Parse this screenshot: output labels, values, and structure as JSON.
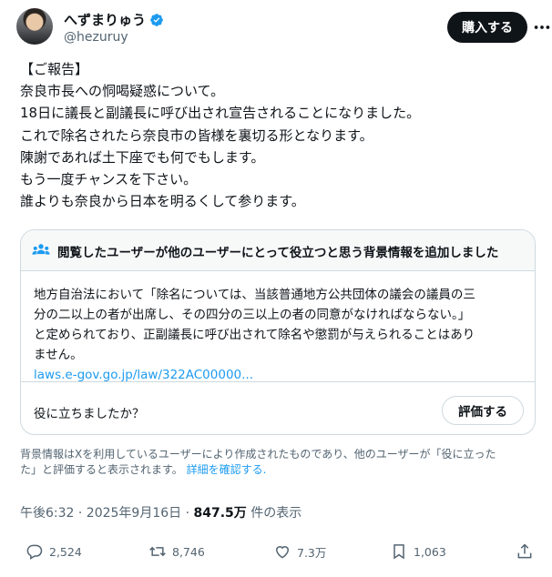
{
  "user": {
    "display_name": "へずまりゅう",
    "handle": "@hezuruy",
    "verified_icon": "verified-badge-icon"
  },
  "header": {
    "buy_label": "購入する",
    "more_icon": "more-icon"
  },
  "tweet": {
    "lines": [
      "【ご報告】",
      "奈良市長への恫喝疑惑について。",
      "18日に議長と副議長に呼び出され宣告されることになりました。",
      "これで除名されたら奈良市の皆様を裏切る形となります。",
      "陳謝であれば土下座でも何でもします。",
      "もう一度チャンスを下さい。",
      "誰よりも奈良から日本を明るくして参ります。"
    ]
  },
  "community_note": {
    "title": "閲覧したユーザーが他のユーザーにとって役立つと思う背景情報を追加しました",
    "body_lines": [
      "地方自治法において「除名については、当該普通地方公共団体の議会の議員の三",
      "分の二以上の者が出席し、その四分の三以上の者の同意がなければならない。」",
      "と定められており、正副議長に呼び出されて除名や懲罰が与えられることはあり",
      "ません。"
    ],
    "link": "laws.e-gov.go.jp/law/322AC00000...",
    "question": "役に立ちましたか？",
    "rate_label": "評価する"
  },
  "disclaimer": {
    "line1": "背景情報はXを利用しているユーザーにより作成されたものであり、他のユーザーが「役に立った",
    "line2_prefix": "た」と評価すると表示されます。",
    "link": "詳細を確認する."
  },
  "meta": {
    "time": "午後6:32 · 2025年9月16日 · ",
    "views": "847.5万",
    "views_label": " 件の表示"
  },
  "actions": {
    "replies": "2,524",
    "reposts": "8,746",
    "likes": "7.3万",
    "bookmarks": "1,063"
  },
  "colors": {
    "accent": "#1d9bf0",
    "text": "#0f1419",
    "muted": "#536471"
  }
}
